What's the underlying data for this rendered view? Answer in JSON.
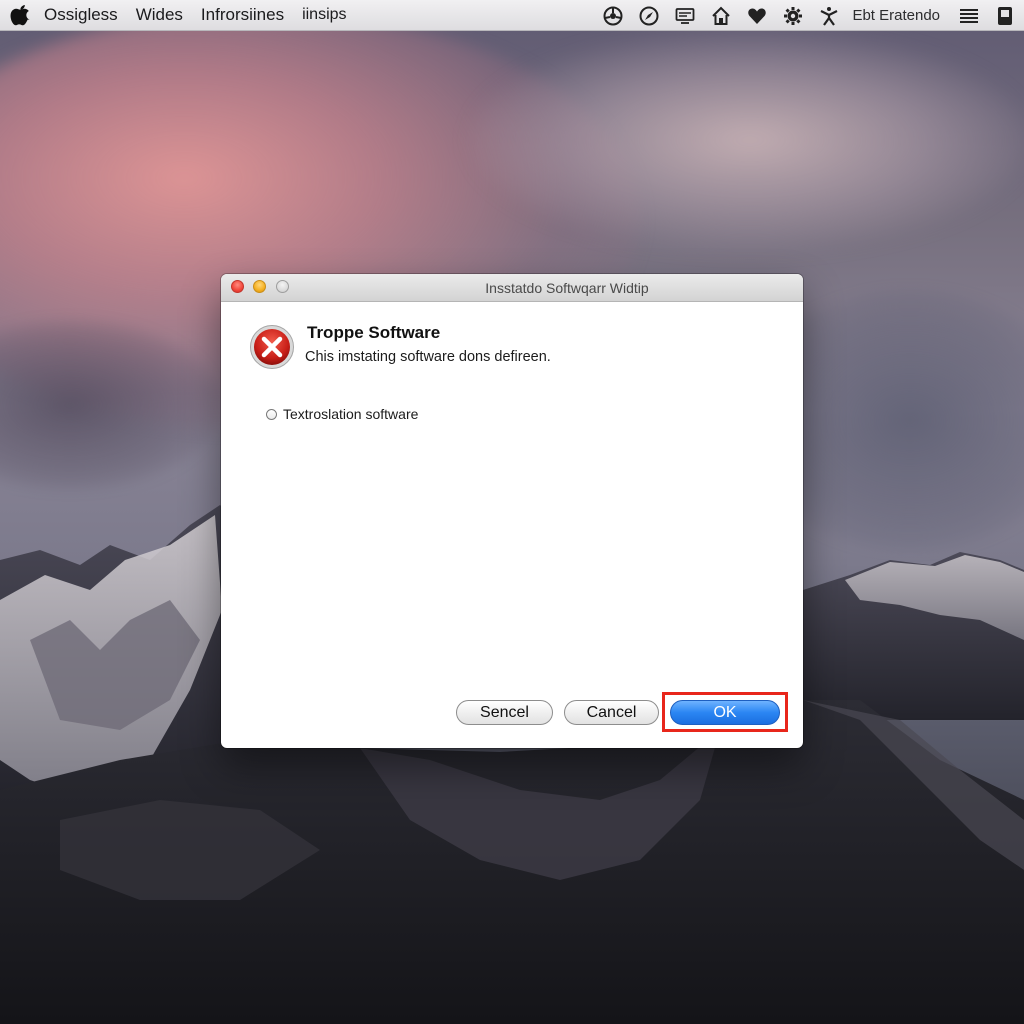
{
  "menubar": {
    "apple_icon": "apple-logo-icon",
    "items": [
      {
        "label": "Ossigless"
      },
      {
        "label": "Wides"
      },
      {
        "label": "Infrorsiines"
      },
      {
        "label": "iinsips"
      }
    ],
    "status_icons": [
      "steering-wheel-icon",
      "compass-icon",
      "display-icon",
      "home-icon",
      "heart-icon",
      "gear-icon",
      "accessibility-icon"
    ],
    "status_text": "Ebt Eratendo",
    "extra_icons": [
      "list-icon",
      "device-icon"
    ]
  },
  "dialog": {
    "window_title": "Insstatdo Softwqarr Widtip",
    "icon": "error-x-icon",
    "heading": "Troppe Software",
    "message": "Chis imstating software dons defireen.",
    "option_label": "Textroslation software",
    "buttons": {
      "sencel": "Sencel",
      "cancel": "Cancel",
      "ok": "OK"
    },
    "highlight_color": "#e8261b"
  },
  "colors": {
    "ok_button": "#2b86f3",
    "close_button": "#f2463a",
    "minimize_button": "#f5b021"
  }
}
